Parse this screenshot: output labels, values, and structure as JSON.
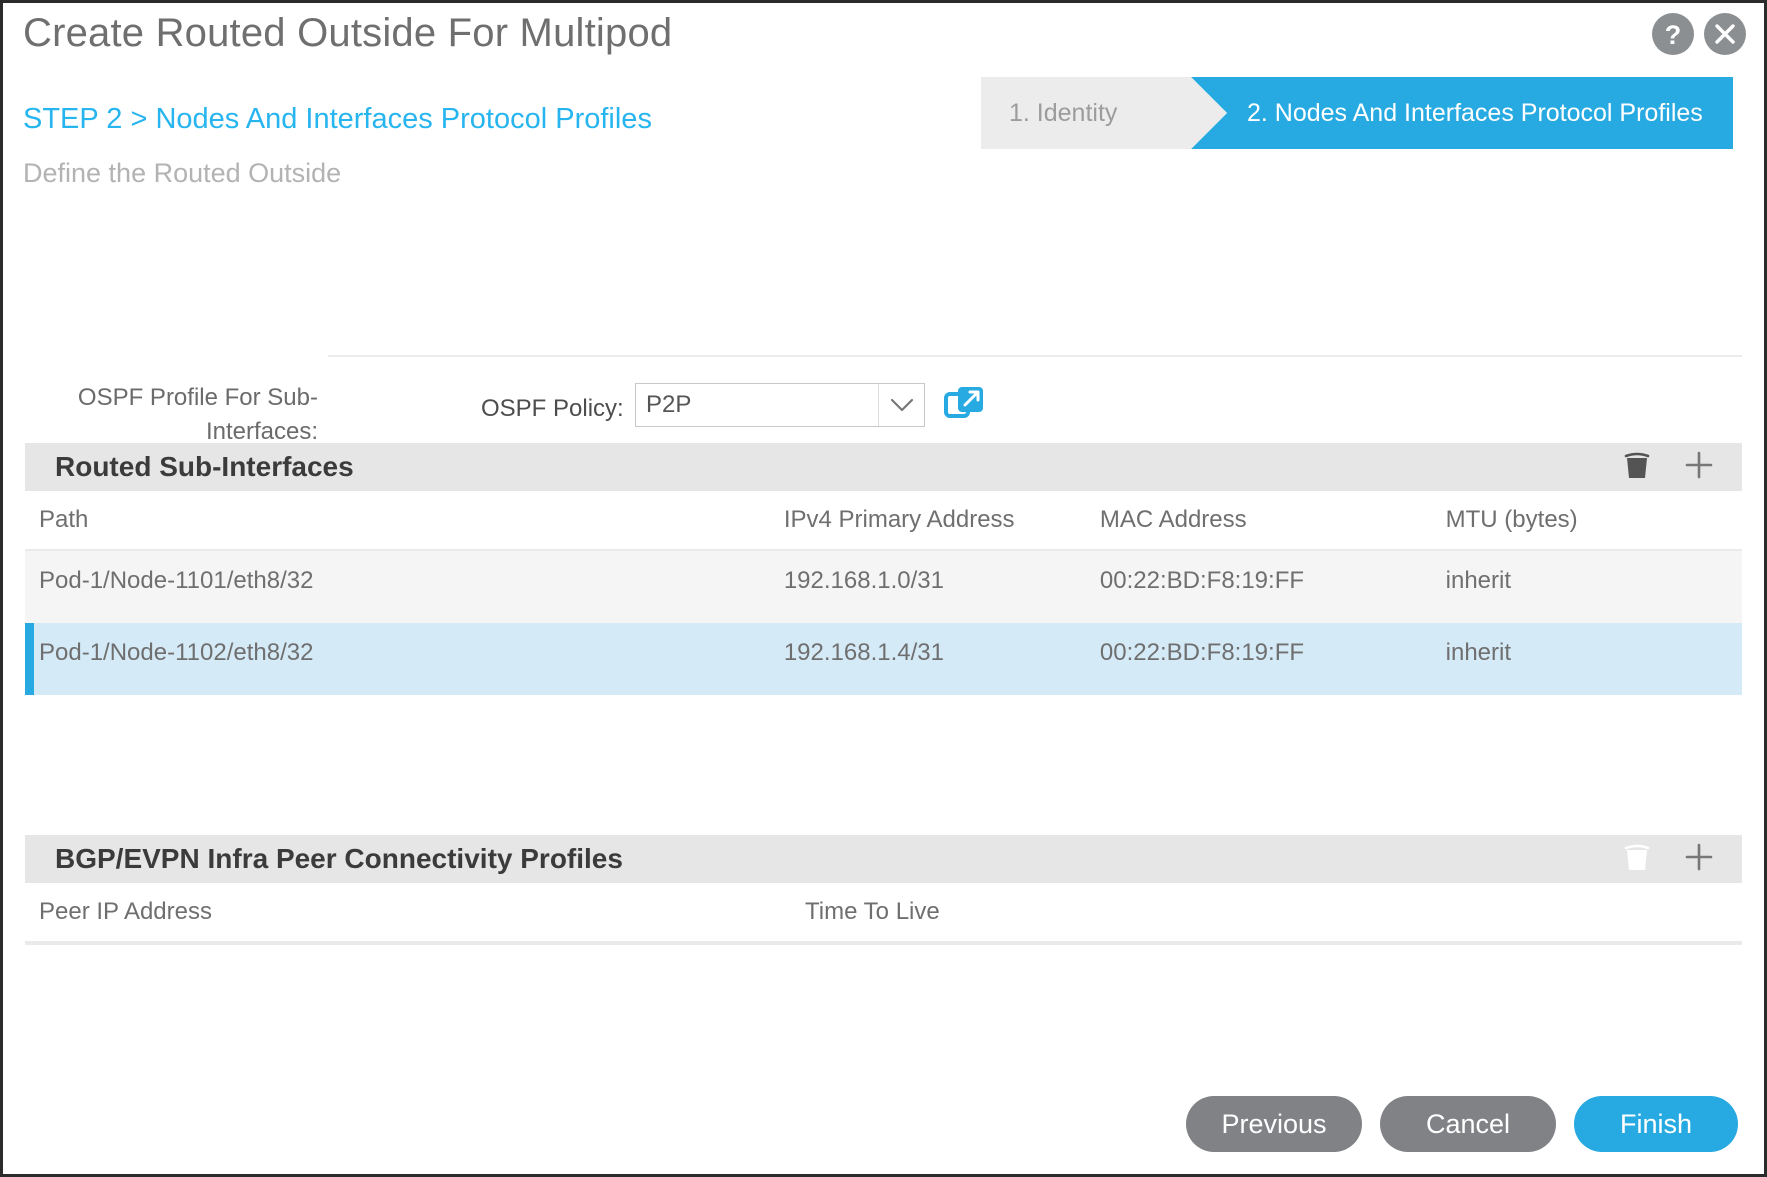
{
  "dialog": {
    "title": "Create Routed Outside For Multipod",
    "help_icon": "question-mark-icon",
    "close_icon": "close-icon"
  },
  "step": {
    "title": "STEP 2 > Nodes And Interfaces Protocol Profiles",
    "subtitle": "Define the Routed Outside",
    "wizard": [
      {
        "label": "1. Identity",
        "state": "inactive"
      },
      {
        "label": "2. Nodes And Interfaces Protocol Profiles",
        "state": "active"
      }
    ]
  },
  "ospf": {
    "profile_label": "OSPF Profile For Sub-Interfaces:",
    "policy_label": "OSPF Policy:",
    "policy_value": "P2P",
    "caret_icon": "chevron-down-icon",
    "launch_icon": "open-in-new-window-icon"
  },
  "routed_sub_interfaces": {
    "title": "Routed Sub-Interfaces",
    "delete_icon": "trash-icon",
    "add_icon": "plus-icon",
    "columns": [
      "Path",
      "IPv4 Primary Address",
      "MAC Address",
      "MTU (bytes)"
    ],
    "rows": [
      {
        "path": "Pod-1/Node-1101/eth8/32",
        "ipv4": "192.168.1.0/31",
        "mac": "00:22:BD:F8:19:FF",
        "mtu": "inherit",
        "selected": false
      },
      {
        "path": "Pod-1/Node-1102/eth8/32",
        "ipv4": "192.168.1.4/31",
        "mac": "00:22:BD:F8:19:FF",
        "mtu": "inherit",
        "selected": true
      }
    ]
  },
  "bgp_evpn": {
    "title": "BGP/EVPN Infra Peer Connectivity Profiles",
    "delete_icon": "trash-icon",
    "add_icon": "plus-icon",
    "columns": [
      "Peer IP Address",
      "Time To Live"
    ],
    "rows": []
  },
  "footer": {
    "previous_label": "Previous",
    "cancel_label": "Cancel",
    "finish_label": "Finish"
  },
  "colors": {
    "accent_blue": "#27aae1",
    "step_link": "#27b5ef",
    "selected_row": "#d4eaf7",
    "header_band": "#e6e6e6",
    "button_grey": "#808285"
  }
}
